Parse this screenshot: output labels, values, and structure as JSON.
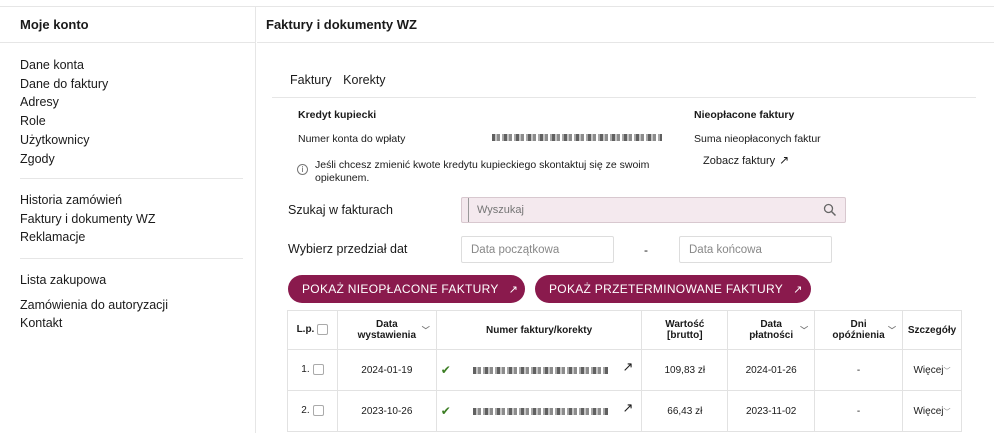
{
  "sidebar": {
    "title": "Moje konto",
    "group1": [
      "Dane konta",
      "Dane do faktury",
      "Adresy",
      "Role",
      "Użytkownicy",
      "Zgody"
    ],
    "group2": [
      "Historia zamówień",
      "Faktury i dokumenty WZ",
      "Reklamacje"
    ],
    "group3": [
      "Lista zakupowa",
      "Zamówienia do autoryzacji",
      "Kontakt"
    ]
  },
  "main": {
    "title": "Faktury i dokumenty WZ",
    "tabs": [
      "Faktury",
      "Korekty"
    ],
    "credit": {
      "heading": "Kredyt kupiecki",
      "account_label": "Numer konta do wpłaty",
      "info": "Jeśli chcesz zmienić kwote kredytu kupieckiego skontaktuj się ze swoim opiekunem."
    },
    "unpaid": {
      "heading": "Nieopłacone faktury",
      "sum_label": "Suma nieopłaconych faktur",
      "link": "Zobacz faktury"
    },
    "search": {
      "label": "Szukaj w fakturach",
      "placeholder": "Wyszukaj"
    },
    "dates": {
      "label": "Wybierz przedział dat",
      "start_placeholder": "Data początkowa",
      "end_placeholder": "Data końcowa",
      "separator": "-"
    },
    "buttons": {
      "unpaid": "POKAŻ NIEOPŁACONE FAKTURY",
      "overdue": "POKAŻ PRZETERMINOWANE FAKTURY"
    },
    "table": {
      "headers": {
        "lp": "L.p.",
        "issue_date": [
          "Data",
          "wystawienia"
        ],
        "number": "Numer faktury/korekty",
        "value": [
          "Wartość",
          "[brutto]"
        ],
        "pay_date": [
          "Data",
          "płatności"
        ],
        "delay": [
          "Dni",
          "opóźnienia"
        ],
        "details": "Szczegóły"
      },
      "rows": [
        {
          "lp": "1.",
          "issue_date": "2024-01-19",
          "value": "109,83 zł",
          "pay_date": "2024-01-26",
          "delay": "-",
          "details": "Więcej"
        },
        {
          "lp": "2.",
          "issue_date": "2023-10-26",
          "value": "66,43 zł",
          "pay_date": "2023-11-02",
          "delay": "-",
          "details": "Więcej"
        }
      ]
    }
  },
  "colors": {
    "accent": "#8a1a4d",
    "search_bg": "#f4e9ee",
    "check": "#3b7d23"
  }
}
